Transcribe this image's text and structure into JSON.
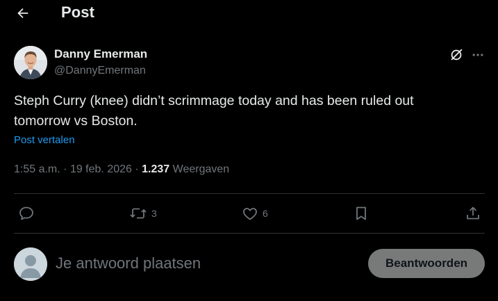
{
  "header": {
    "back_icon": "arrow-left-icon",
    "title": "Post"
  },
  "author": {
    "name": "Danny Emerman",
    "handle": "@DannyEmerman",
    "avatar_icon": "user-photo-avatar"
  },
  "post": {
    "text": "Steph Curry (knee) didn’t scrimmage today and has been ruled out tomorrow vs Boston.",
    "translate_label": "Post vertalen",
    "time": "1:55 a.m.",
    "separator": "·",
    "date": "19 feb. 2026",
    "views_count": "1.237",
    "views_label": "Weergaven"
  },
  "actions": {
    "reply": {
      "icon": "reply-bubble-icon",
      "count": ""
    },
    "repost": {
      "icon": "repost-icon",
      "count": "3"
    },
    "like": {
      "icon": "heart-icon",
      "count": "6"
    },
    "bookmark": {
      "icon": "bookmark-icon",
      "count": ""
    },
    "share": {
      "icon": "share-icon",
      "count": ""
    }
  },
  "reply_composer": {
    "placeholder": "Je antwoord plaatsen",
    "value": "",
    "button_label": "Beantwoorden"
  },
  "colors": {
    "background": "#000000",
    "text_primary": "#e7e9ea",
    "text_secondary": "#71767b",
    "link": "#1d9bf0",
    "divider": "#2f3336",
    "reply_button_bg": "#787a7a"
  }
}
